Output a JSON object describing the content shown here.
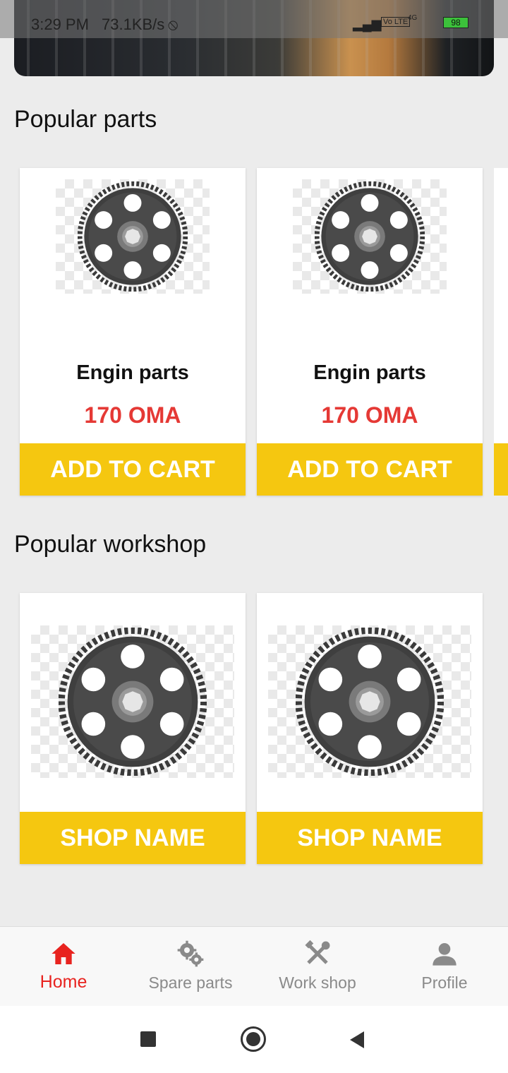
{
  "status_bar": {
    "time": "3:29 PM",
    "speed": "73.1KB/s",
    "network": "4G",
    "volte": "Vo LTE",
    "battery": "98"
  },
  "sections": {
    "popular_parts_title": "Popular parts",
    "popular_workshop_title": "Popular workshop"
  },
  "parts": [
    {
      "name": "Engin parts",
      "price": "170 OMA",
      "button": "ADD TO CART"
    },
    {
      "name": "Engin parts",
      "price": "170 OMA",
      "button": "ADD TO CART"
    }
  ],
  "workshops": [
    {
      "name": "SHOP NAME"
    },
    {
      "name": "SHOP NAME"
    }
  ],
  "bottom_nav": {
    "items": [
      {
        "label": "Home",
        "icon": "home-icon",
        "active": true
      },
      {
        "label": "Spare parts",
        "icon": "gears-icon",
        "active": false
      },
      {
        "label": "Work shop",
        "icon": "tools-icon",
        "active": false
      },
      {
        "label": "Profile",
        "icon": "person-icon",
        "active": false
      }
    ]
  },
  "colors": {
    "accent_yellow": "#f5c710",
    "price_red": "#e53935",
    "active_nav_red": "#e8231f",
    "inactive_nav_gray": "#8a8a8a",
    "background": "#ececec"
  }
}
